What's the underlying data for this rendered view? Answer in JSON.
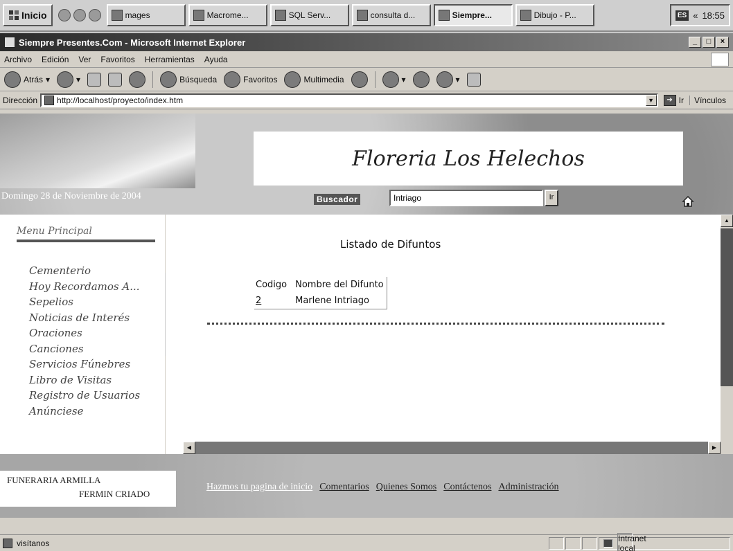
{
  "taskbar": {
    "start_label": "Inicio",
    "buttons": [
      {
        "label": "mages",
        "active": false
      },
      {
        "label": "Macrome...",
        "active": false
      },
      {
        "label": "SQL Serv...",
        "active": false
      },
      {
        "label": "consulta d...",
        "active": false
      },
      {
        "label": "Siempre...",
        "active": true
      },
      {
        "label": "Dibujo - P...",
        "active": false
      }
    ],
    "lang": "ES",
    "clock": "18:55"
  },
  "window": {
    "title": "Siempre Presentes.Com - Microsoft Internet Explorer",
    "menu": [
      "Archivo",
      "Edición",
      "Ver",
      "Favoritos",
      "Herramientas",
      "Ayuda"
    ],
    "toolbar": {
      "back": "Atrás",
      "search": "Búsqueda",
      "favorites": "Favoritos",
      "multimedia": "Multimedia"
    },
    "address": {
      "label": "Dirección",
      "url": "http://localhost/proyecto/index.htm",
      "go": "Ir",
      "links": "Vínculos"
    }
  },
  "page": {
    "banner_title": "Floreria Los Helechos",
    "date": "Domingo 28 de Noviembre de 2004",
    "search": {
      "label": "Buscador",
      "value": "Intriago",
      "button": "Ir"
    },
    "menu_title": "Menu Principal",
    "menu_items": [
      "Cementerio",
      "Hoy Recordamos A...",
      "Sepelios",
      "Noticias de Interés",
      "Oraciones",
      "Canciones",
      "Servicios Fúnebres",
      "Libro de Visitas",
      "Registro de Usuarios",
      "Anúnciese"
    ],
    "list_title": "Listado de Difuntos",
    "table": {
      "headers": [
        "Codigo",
        "Nombre del Difunto"
      ],
      "rows": [
        {
          "code": "2",
          "name": "Marlene Intriago"
        }
      ]
    },
    "footer_logo": {
      "line1": "FUNERARIA ARMILLA",
      "line2": "FERMIN CRIADO"
    },
    "footer_links": [
      "Hazmos tu pagina de inicio",
      "Comentarios",
      "Quienes Somos",
      "Contáctenos",
      "Administración"
    ]
  },
  "status": {
    "text": "visítanos",
    "zone": "Intranet local"
  }
}
